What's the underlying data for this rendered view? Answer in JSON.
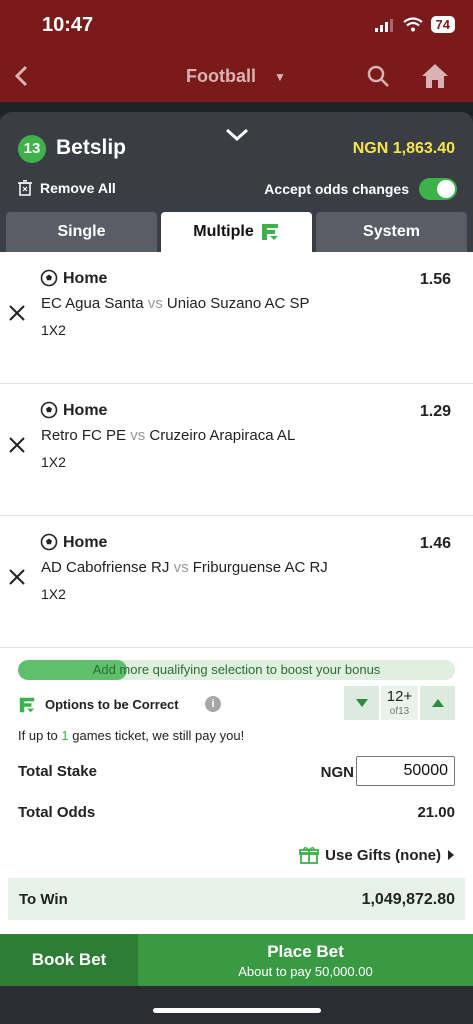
{
  "status_bar": {
    "time": "10:47",
    "battery": "74"
  },
  "nav": {
    "title": "Football"
  },
  "betslip": {
    "count": "13",
    "title": "Betslip",
    "balance": "NGN 1,863.40",
    "remove_all": "Remove All",
    "accept_odds": "Accept odds changes",
    "accept_odds_on": true
  },
  "tabs": [
    {
      "label": "Single"
    },
    {
      "label": "Multiple"
    },
    {
      "label": "System"
    }
  ],
  "bets": [
    {
      "pick": "Home",
      "odds": "1.56",
      "home": "EC Agua Santa",
      "vs": "vs",
      "away": "Uniao Suzano AC SP",
      "market": "1X2"
    },
    {
      "pick": "Home",
      "odds": "1.29",
      "home": "Retro FC PE",
      "vs": "vs",
      "away": "Cruzeiro Arapiraca AL",
      "market": "1X2"
    },
    {
      "pick": "Home",
      "odds": "1.46",
      "home": "AD Cabofriense RJ",
      "vs": "vs",
      "away": "Friburguense AC RJ",
      "market": "1X2"
    }
  ],
  "bonus": {
    "text": "Add more qualifying selection to boost your bonus",
    "progress": 0.25
  },
  "options": {
    "label": "Options to be Correct",
    "value": "12+",
    "of": "of13",
    "guarantee_pre": "If up to",
    "guarantee_num": "1",
    "guarantee_post": "games ticket, we still pay you!"
  },
  "stake": {
    "label": "Total Stake",
    "currency": "NGN",
    "value": "50000"
  },
  "total_odds": {
    "label": "Total Odds",
    "value": "21.00"
  },
  "gifts": {
    "label": "Use Gifts (none)"
  },
  "to_win": {
    "label": "To Win",
    "value": "1,049,872.80"
  },
  "actions": {
    "book_bet": "Book Bet",
    "place_bet": "Place Bet",
    "place_bet_sub": "About to pay 50,000.00"
  },
  "colors": {
    "header": "#7a1a1a",
    "accent_green": "#3db24b",
    "balance_yellow": "#f5e64a",
    "sheet": "#3a3d44"
  }
}
